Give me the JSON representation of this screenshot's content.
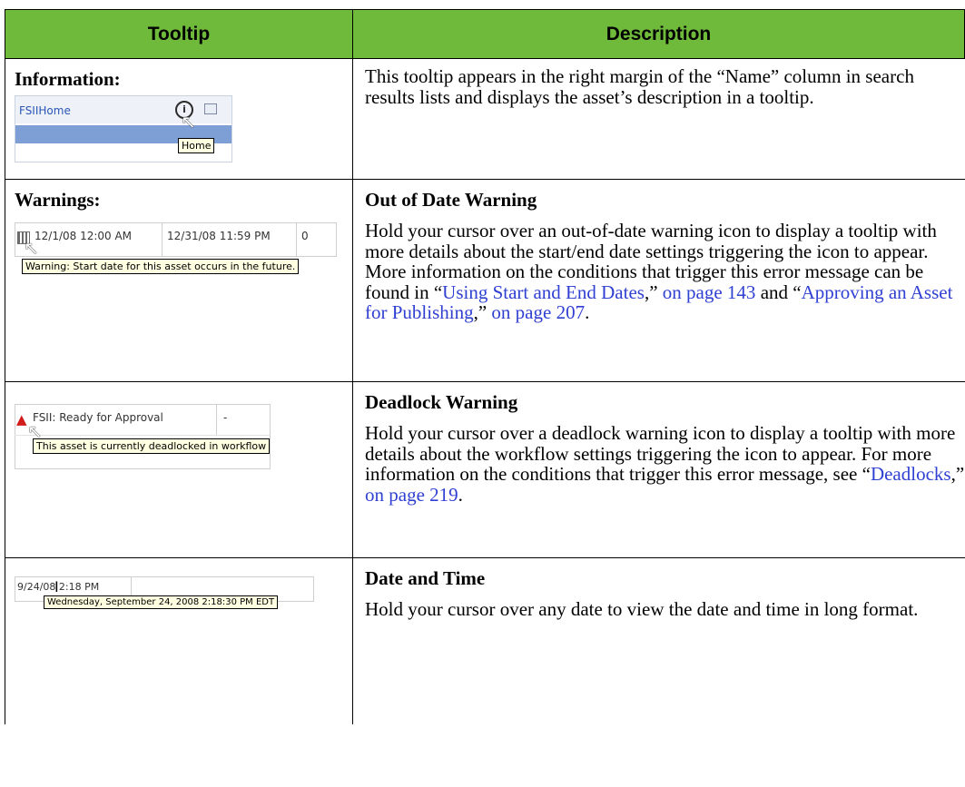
{
  "header": {
    "col1": "Tooltip",
    "col2": "Description"
  },
  "rows": [
    {
      "label": "Information:",
      "desc_title": "",
      "desc_parts": [
        {
          "text": "This tooltip appears in the right margin of the “Name” column in search results lists and displays the asset’s description in a tooltip.",
          "link": false
        }
      ],
      "shot": {
        "name_text": "FSIIHome",
        "tooltip": "Home"
      }
    },
    {
      "label": "Warnings:",
      "desc_title": "Out of Date Warning",
      "desc_parts": [
        {
          "text": "Hold your cursor over an out-of-date warning icon to display a tooltip with more details about the start/end date settings triggering the icon to appear. More information on the conditions that trigger this error message can be found in “",
          "link": false
        },
        {
          "text": "Using Start and End Dates",
          "link": true
        },
        {
          "text": ",” ",
          "link": false
        },
        {
          "text": "on page 143",
          "link": true
        },
        {
          "text": " and “",
          "link": false
        },
        {
          "text": "Approving an Asset for Publishing",
          "link": true
        },
        {
          "text": ",” ",
          "link": false
        },
        {
          "text": "on page 207",
          "link": true
        },
        {
          "text": ".",
          "link": false
        }
      ],
      "shot": {
        "start": "12/1/08 12:00 AM",
        "end": "12/31/08 11:59 PM",
        "count": "0",
        "tooltip": "Warning: Start date for this asset occurs in the future."
      }
    },
    {
      "label": "",
      "desc_title": "Deadlock Warning",
      "desc_parts": [
        {
          "text": "Hold your cursor over a deadlock warning icon to display a tooltip with more details about the workflow settings triggering the icon to appear. For more information on the conditions that trigger this error message, see “",
          "link": false
        },
        {
          "text": "Deadlocks",
          "link": true
        },
        {
          "text": ",” ",
          "link": false
        },
        {
          "text": "on page 219",
          "link": true
        },
        {
          "text": ".",
          "link": false
        }
      ],
      "shot": {
        "status": "FSII: Ready for Approval",
        "dash": "-",
        "tooltip": "This asset is currently deadlocked in workflow"
      }
    },
    {
      "label": "",
      "desc_title": "Date and Time",
      "desc_parts": [
        {
          "text": "Hold your cursor over any date to view the date and time in long format.",
          "link": false
        }
      ],
      "shot": {
        "date": "9/24/08 2:18 PM",
        "tooltip": "Wednesday, September 24, 2008 2:18:30 PM EDT"
      }
    }
  ]
}
